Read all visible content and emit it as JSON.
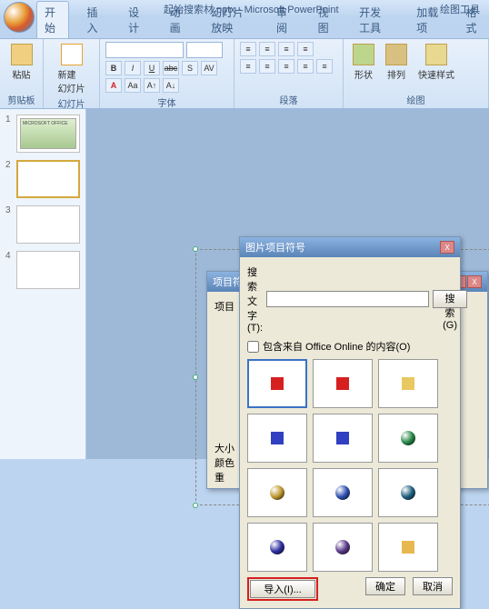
{
  "title_bar": {
    "document": "起始搜索材.pptx - Microsoft PowerPoint",
    "context_tab": "绘图工具"
  },
  "tabs": {
    "home": "开始",
    "insert": "插入",
    "design": "设计",
    "anim": "动画",
    "slideshow": "幻灯片放映",
    "review": "审阅",
    "view": "视图",
    "dev": "开发工具",
    "addin": "加载项",
    "format": "格式"
  },
  "ribbon": {
    "clipboard": {
      "paste": "粘贴",
      "label": "剪贴板"
    },
    "slides": {
      "new_slide": "新建\n幻灯片",
      "label": "幻灯片"
    },
    "font": {
      "label": "字体",
      "family": "",
      "size": "",
      "b": "B",
      "i": "I",
      "u": "U",
      "s": "abc",
      "shadow": "S",
      "av": "AV"
    },
    "paragraph": {
      "label": "段落"
    },
    "drawing": {
      "shape": "形状",
      "arrange": "排列",
      "quick": "快速样式",
      "label": "绘图"
    }
  },
  "slides_panel": {
    "n1": "1",
    "n2": "2",
    "n3": "3",
    "n4": "4"
  },
  "back_dialog": {
    "title": "项目符号和编号",
    "tab": "项目",
    "size_lbl": "大小",
    "color_lbl": "颜色",
    "reset_lbl": "重"
  },
  "dialog": {
    "title": "图片项目符号",
    "search_label": "搜索文字(T):",
    "search_btn": "搜索(G)",
    "include_label": "包含来自 Office Online 的内容(O)",
    "import_btn": "导入(I)...",
    "ok_btn": "确定",
    "cancel_btn": "取消"
  },
  "bullets": [
    {
      "type": "square",
      "color": "#d62020"
    },
    {
      "type": "square",
      "color": "#d62020"
    },
    {
      "type": "square",
      "color": "#e8c860"
    },
    {
      "type": "square",
      "color": "#3040c0"
    },
    {
      "type": "square",
      "color": "#3040c0"
    },
    {
      "type": "sphere",
      "color": "#2a8a4a"
    },
    {
      "type": "sphere",
      "color": "#c09830"
    },
    {
      "type": "sphere",
      "color": "#3050b0"
    },
    {
      "type": "sphere",
      "color": "#206080"
    },
    {
      "type": "sphere",
      "color": "#3030a0"
    },
    {
      "type": "sphere",
      "color": "#5a3a8a"
    },
    {
      "type": "square",
      "color": "#e8b850"
    }
  ]
}
